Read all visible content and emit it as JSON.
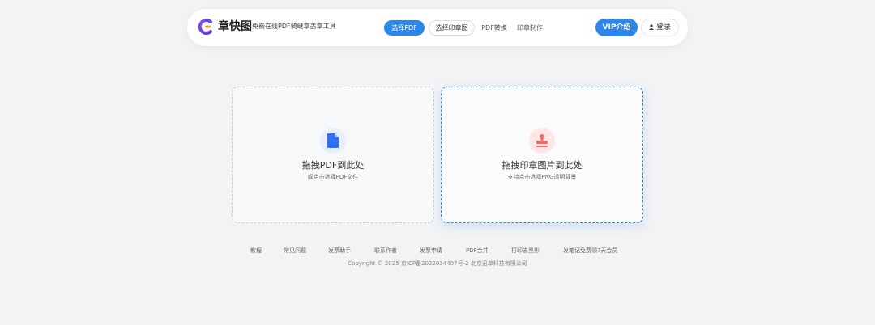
{
  "header": {
    "brand_name": "章快图",
    "tagline": "免费在线PDF骑缝章盖章工具",
    "tabs": [
      {
        "label": "选择PDF",
        "active": true
      },
      {
        "label": "选择印章图",
        "active": false
      },
      {
        "label": "PDF转换",
        "active": false
      },
      {
        "label": "印章制作",
        "active": false
      }
    ],
    "vip_label": "VIP介绍",
    "login_label": "登录"
  },
  "upload": {
    "pdf_card": {
      "title": "拖拽PDF到此处",
      "subtitle": "或点击选择PDF文件",
      "icon": "document-icon"
    },
    "stamp_card": {
      "title": "拖拽印章图片到此处",
      "subtitle": "支持点击选择PNG透明背景",
      "icon": "stamp-icon"
    }
  },
  "footer": {
    "links": [
      {
        "label": "教程"
      },
      {
        "label": "常见问题"
      },
      {
        "label": "发票助手"
      },
      {
        "label": "联系作者"
      },
      {
        "label": "发票申请"
      },
      {
        "label": "PDF合并"
      },
      {
        "label": "打印去黑影"
      },
      {
        "label": "发笔记免费领7天会员"
      }
    ],
    "copyright": "Copyright © 2025 京ICP备2022034407号-2 北京迅单科技有限公司"
  },
  "colors": {
    "accent": "#2f86ea",
    "page_bg": "#f2f3f5",
    "stamp_red": "#f06a6a",
    "doc_blue": "#2f6ff0",
    "logo_purple": "#6b4cf0"
  }
}
